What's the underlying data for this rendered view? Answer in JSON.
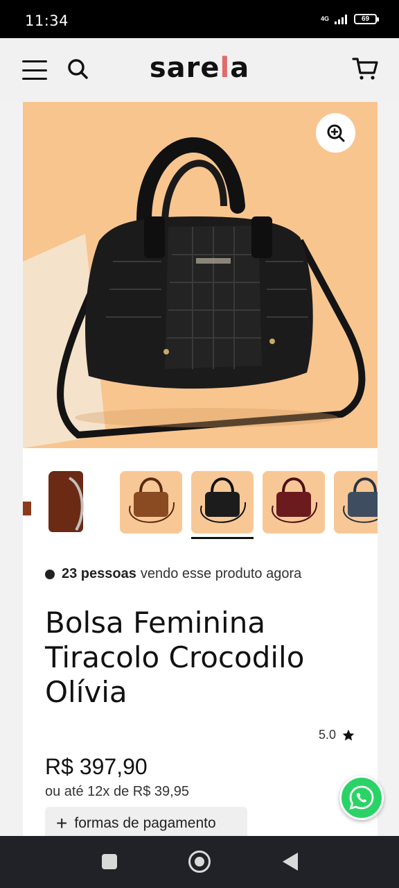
{
  "status_bar": {
    "time": "11:34",
    "network": "4G",
    "battery": "69"
  },
  "header": {
    "logo_left": "sare",
    "logo_accent": "l",
    "logo_right": "a",
    "icons": [
      "menu-icon",
      "search-icon",
      "cart-icon"
    ]
  },
  "product": {
    "viewers_bold": "23 pessoas",
    "viewers_text": "vendo esse produto agora",
    "title": "Bolsa Feminina Tiracolo Crocodilo Olívia",
    "rating": "5.0",
    "price": "R$ 397,90",
    "installments": "ou até 12x de R$ 39,95",
    "payment_button": "formas de pagamento"
  },
  "thumbnails": {
    "colors": [
      "#6b2a14",
      "#8a4a22",
      "#1c1c1c",
      "#6b1a1e",
      "#3e4e60"
    ],
    "selected_index": 2
  },
  "colors": {
    "background": "#f2f2f2",
    "accent_logo": "#e06b6b",
    "whatsapp": "#2bd366",
    "image_bg": "#f7c38f"
  }
}
